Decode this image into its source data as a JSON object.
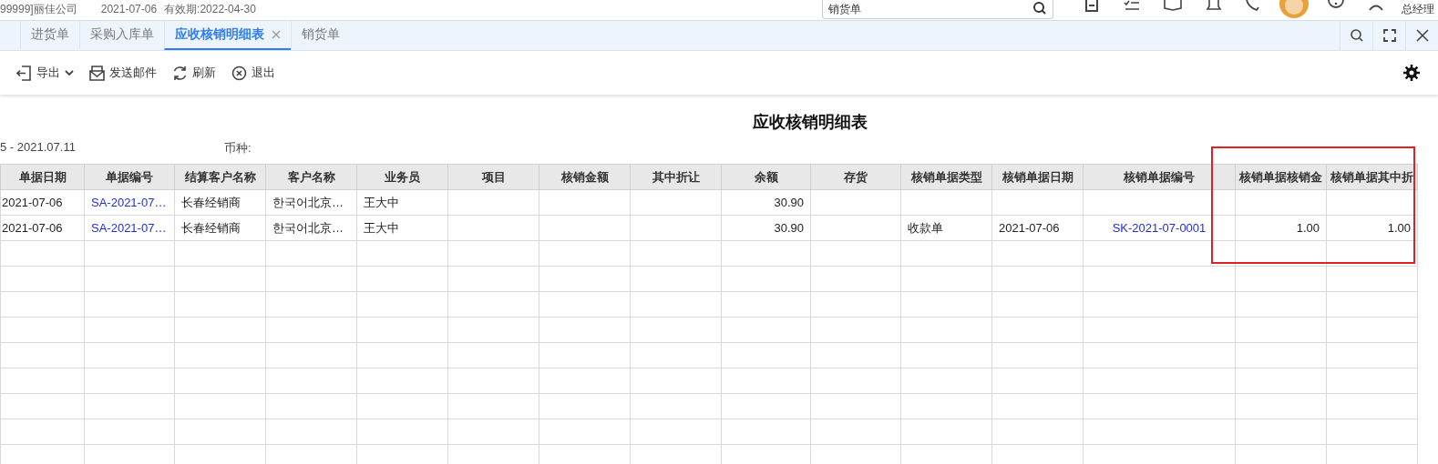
{
  "header": {
    "company": "99999]丽佳公司",
    "date": "2021-07-06",
    "validity": "有效期:2022-04-30",
    "search": {
      "value": "销货单"
    },
    "user": "总经理"
  },
  "tabs": [
    {
      "label": "进货单",
      "selected": false
    },
    {
      "label": "采购入库单",
      "selected": false
    },
    {
      "label": "应收核销明细表",
      "selected": true
    },
    {
      "label": "销货单",
      "selected": false
    }
  ],
  "toolbar": [
    {
      "label": "导出",
      "kind": "export"
    },
    {
      "label": "发送邮件",
      "kind": "mail"
    },
    {
      "label": "刷新",
      "kind": "refresh"
    },
    {
      "label": "退出",
      "kind": "exit"
    }
  ],
  "report": {
    "title": "应收核销明细表",
    "period": "5 - 2021.07.11",
    "currency_label": "币种:"
  },
  "table": {
    "columns": [
      {
        "label": "单据日期",
        "highlighted": false
      },
      {
        "label": "单据编号",
        "highlighted": false
      },
      {
        "label": "结算客户名称",
        "highlighted": false
      },
      {
        "label": "客户名称",
        "highlighted": false
      },
      {
        "label": "业务员",
        "highlighted": false
      },
      {
        "label": "项目",
        "highlighted": false
      },
      {
        "label": "核销金额",
        "highlighted": false
      },
      {
        "label": "其中折让",
        "highlighted": false
      },
      {
        "label": "余额",
        "highlighted": false
      },
      {
        "label": "存货",
        "highlighted": false
      },
      {
        "label": "核销单据类型",
        "highlighted": false
      },
      {
        "label": "核销单据日期",
        "highlighted": false
      },
      {
        "label": "核销单据编号",
        "highlighted": false
      },
      {
        "label": "核销单据核销金",
        "highlighted": true
      },
      {
        "label": "核销单据其中折",
        "highlighted": true
      }
    ],
    "rows": [
      [
        "2021-07-06",
        "SA-2021-07…",
        "长春经销商",
        "한국어北京…",
        "王大中",
        "",
        "",
        "",
        "30.90",
        "",
        "",
        "",
        "",
        "",
        ""
      ],
      [
        "2021-07-06",
        "SA-2021-07…",
        "长春经销商",
        "한국어北京…",
        "王大中",
        "",
        "",
        "",
        "30.90",
        "",
        "收款单",
        "2021-07-06",
        "SK-2021-07-0001",
        "1.00",
        "1.00"
      ]
    ]
  }
}
